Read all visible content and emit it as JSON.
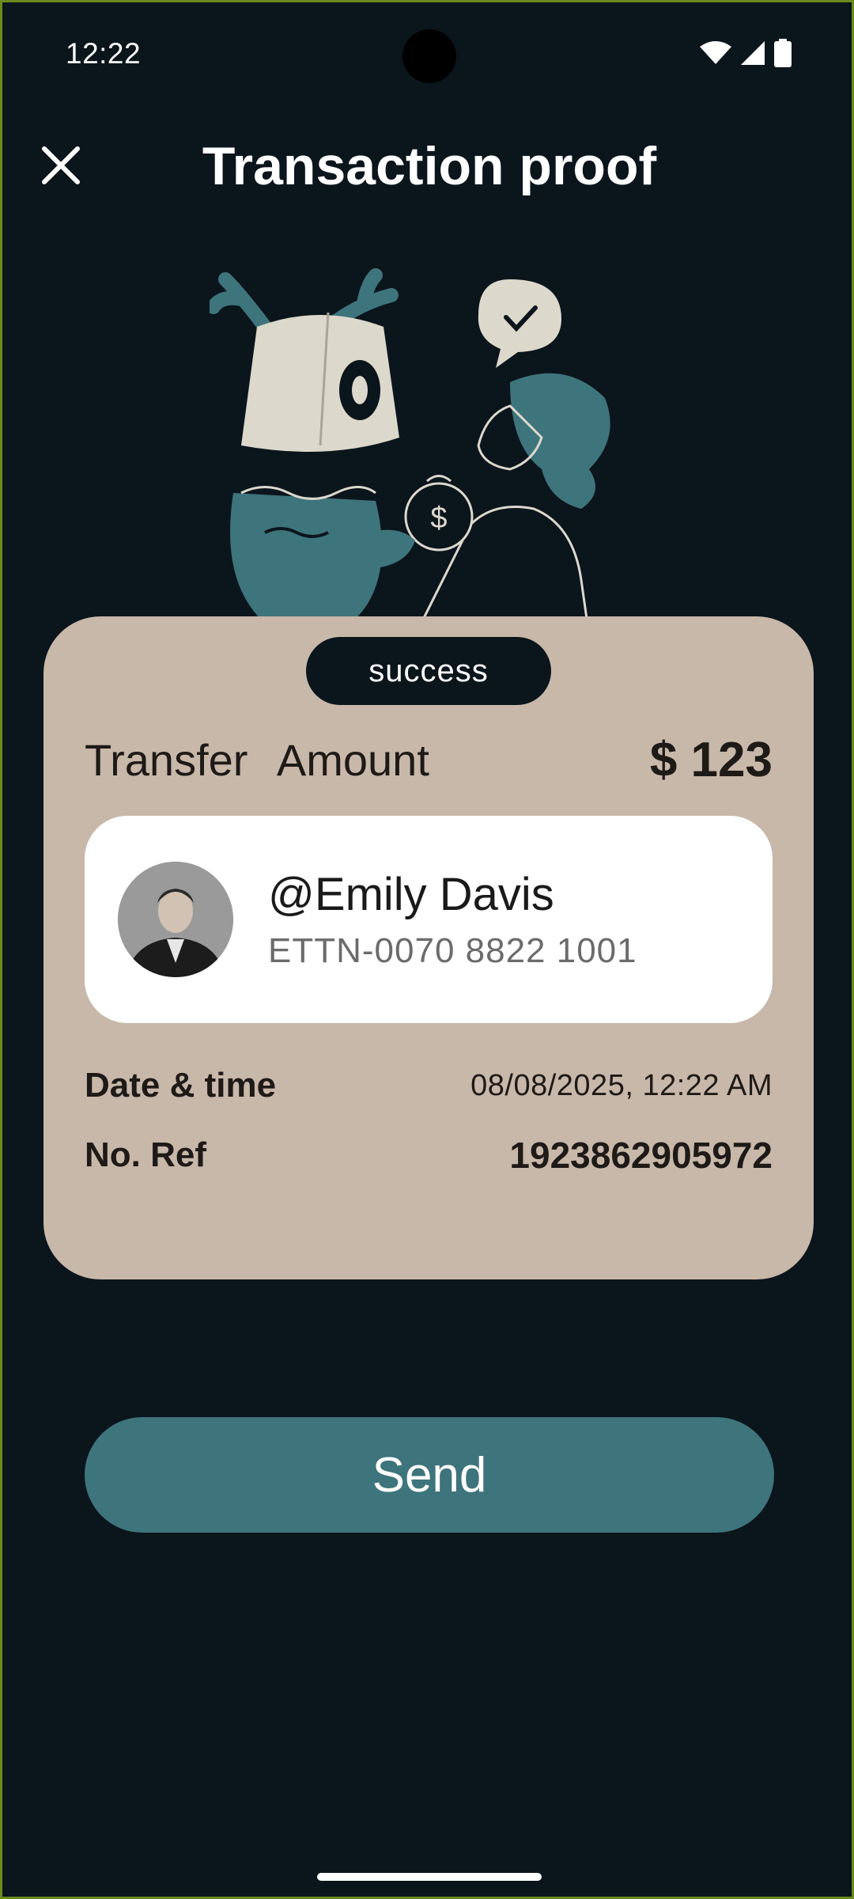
{
  "status_bar": {
    "time": "12:22",
    "icons": [
      "wifi-icon",
      "cellular-signal-icon",
      "battery-icon"
    ]
  },
  "header": {
    "title": "Transaction proof",
    "close_icon": "close-icon"
  },
  "receipt": {
    "status": "success",
    "amount_label": "Transfer Amount",
    "amount_value": "$ 123",
    "recipient": {
      "name": "@Emily Davis",
      "account": "ETTN-0070 8822 1001"
    },
    "date_label": "Date & time",
    "date_value": "08/08/2025, 12:22 AM",
    "ref_label": "No. Ref",
    "ref_value": "1923862905972"
  },
  "actions": {
    "send_label": "Send"
  },
  "colors": {
    "background": "#0b151c",
    "card": "#c8b8aa",
    "accent": "#3e747c",
    "text_dark": "#1e1a17"
  }
}
